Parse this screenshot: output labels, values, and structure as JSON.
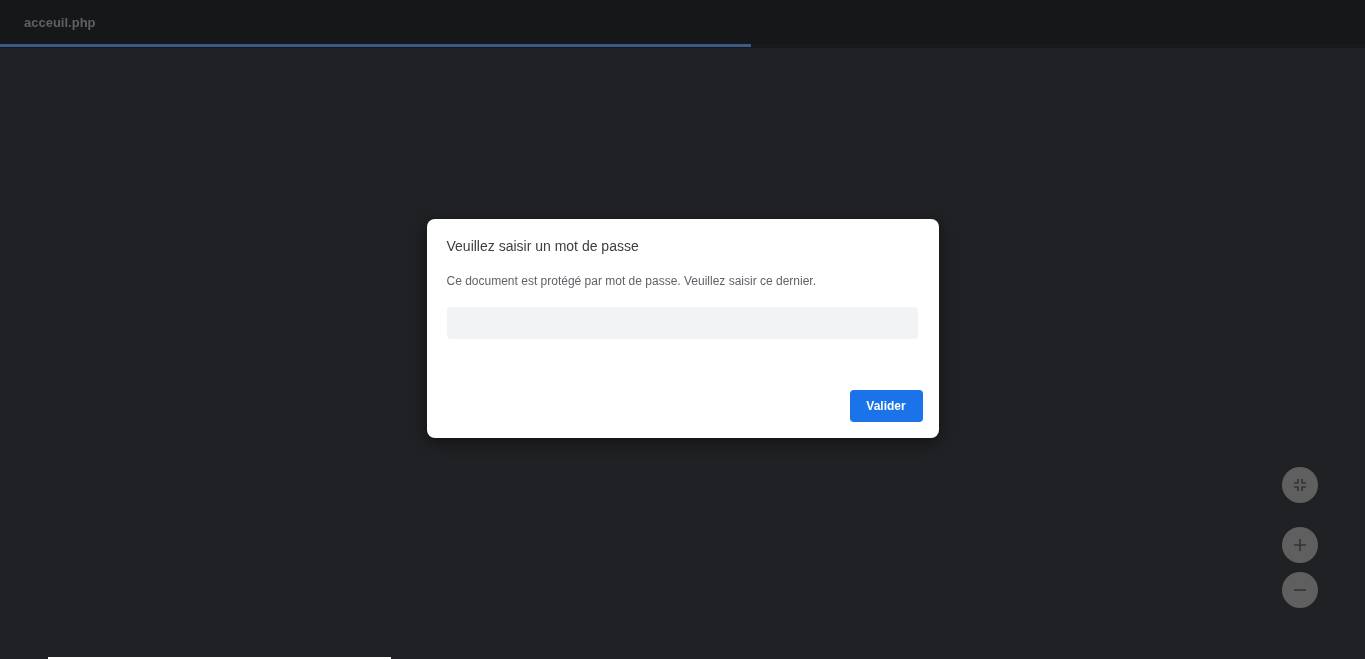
{
  "tab": {
    "title": "acceuil.php",
    "progress": {
      "level": 0.55
    }
  },
  "dialog": {
    "title": "Veuillez saisir un mot de passe",
    "message": "Ce document est protégé par mot de passe. Veuillez saisir ce dernier.",
    "buttons": [
      "Valider"
    ]
  }
}
